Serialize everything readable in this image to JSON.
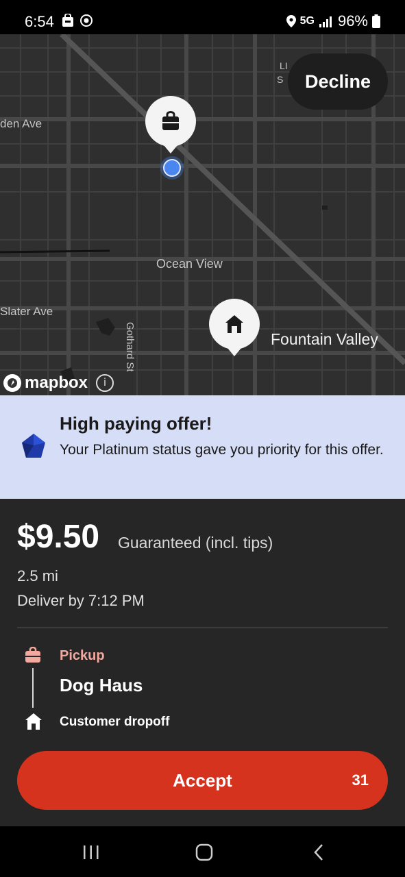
{
  "status_bar": {
    "time": "6:54",
    "network": "5G",
    "battery": "96%"
  },
  "map": {
    "labels": {
      "den_ave": "den Ave",
      "slater_ave": "Slater Ave",
      "ocean_view": "Ocean View",
      "gothard_st": "Gothard St",
      "fountain_valley": "Fountain Valley",
      "partial_top": "LI",
      "partial_top2": "S"
    },
    "attribution": "mapbox",
    "info_glyph": "i"
  },
  "decline_label": "Decline",
  "promo": {
    "title": "High paying offer!",
    "text": "Your Platinum status gave you priority for this offer."
  },
  "offer": {
    "price": "$9.50",
    "price_note": "Guaranteed (incl. tips)",
    "distance": "2.5 mi",
    "deliver_by": "Deliver by 7:12 PM"
  },
  "route": {
    "pickup_label": "Pickup",
    "store_name": "Dog Haus",
    "dropoff_label": "Customer dropoff"
  },
  "accept": {
    "label": "Accept",
    "countdown": "31"
  },
  "colors": {
    "accent_red": "#d6331f",
    "promo_bg": "#d6ddf7",
    "pickup_pink": "#f2a9a0",
    "sheet_bg": "#262626"
  }
}
